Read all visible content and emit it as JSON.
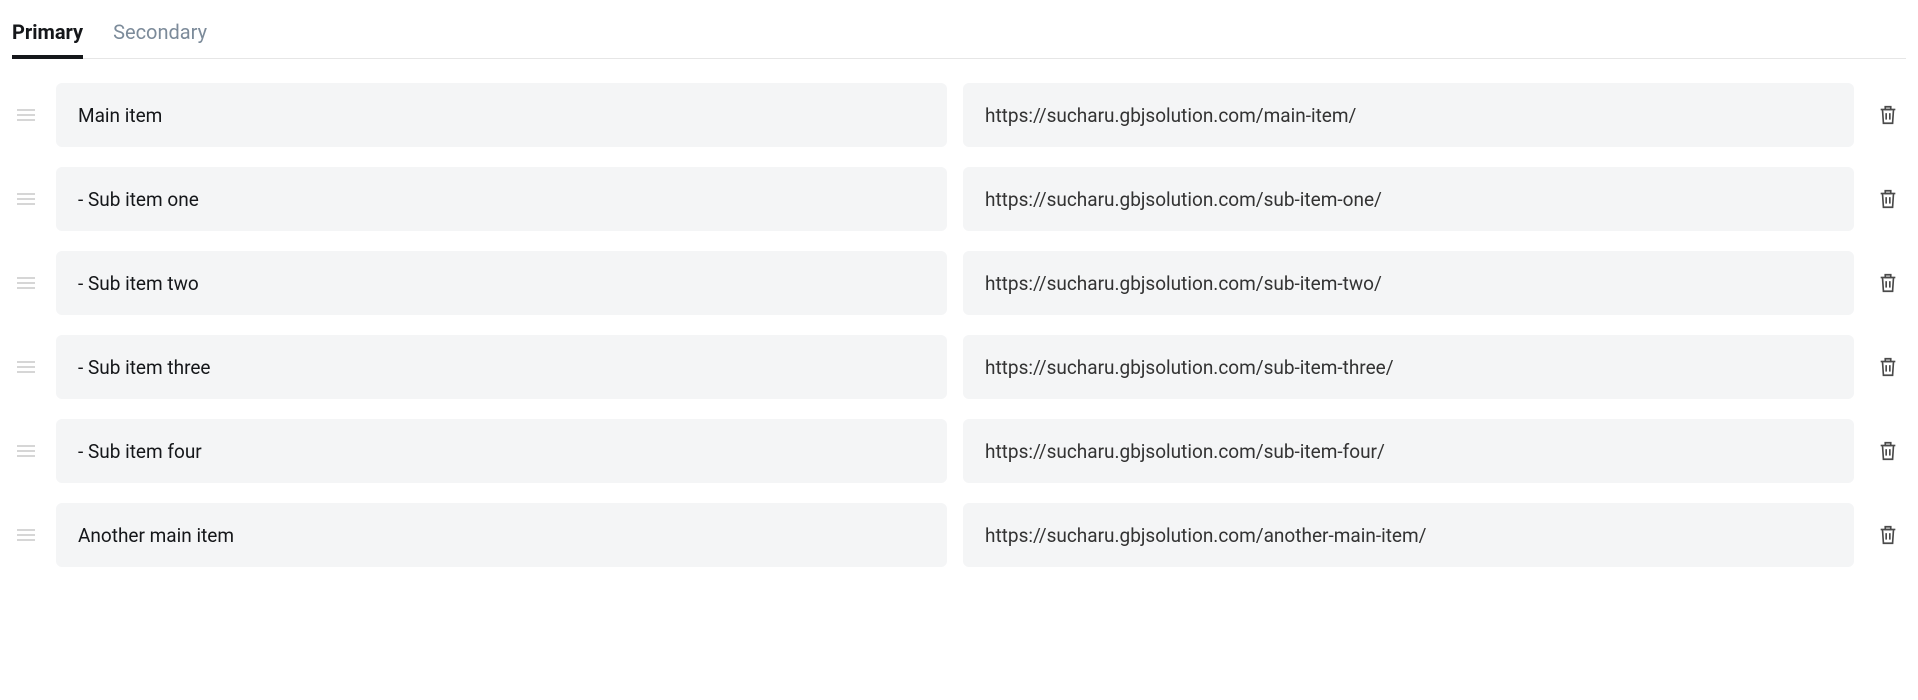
{
  "tabs": [
    {
      "label": "Primary",
      "active": true
    },
    {
      "label": "Secondary",
      "active": false
    }
  ],
  "items": [
    {
      "label": "Main item",
      "url": "https://sucharu.gbjsolution.com/main-item/"
    },
    {
      "label": "- Sub item one",
      "url": "https://sucharu.gbjsolution.com/sub-item-one/"
    },
    {
      "label": "- Sub item two",
      "url": "https://sucharu.gbjsolution.com/sub-item-two/"
    },
    {
      "label": "- Sub item three",
      "url": "https://sucharu.gbjsolution.com/sub-item-three/"
    },
    {
      "label": "- Sub item four",
      "url": "https://sucharu.gbjsolution.com/sub-item-four/"
    },
    {
      "label": "Another main item",
      "url": "https://sucharu.gbjsolution.com/another-main-item/"
    }
  ]
}
